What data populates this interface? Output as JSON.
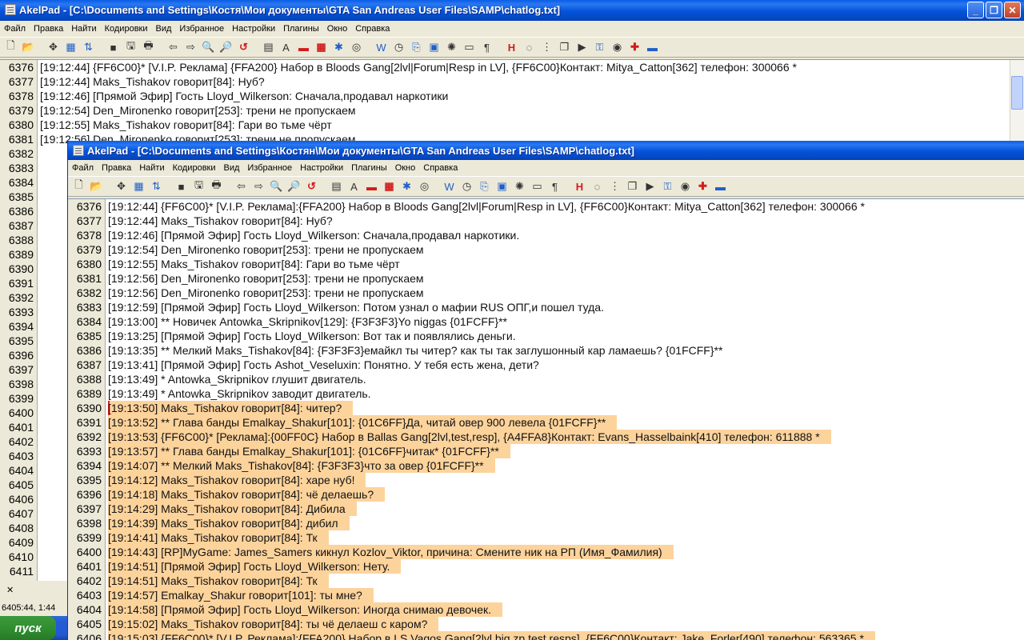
{
  "back_window": {
    "title": "AkelPad - [C:\\Documents and Settings\\Костя\\Мои документы\\GTA San Andreas User Files\\SAMP\\chatlog.txt]",
    "menu": [
      "Файл",
      "Правка",
      "Найти",
      "Кодировки",
      "Вид",
      "Избранное",
      "Настройки",
      "Плагины",
      "Окно",
      "Справка"
    ],
    "lines": [
      {
        "n": "6376",
        "t": "[19:12:44] {FF6C00}* [V.I.P. Реклама] {FFA200} Набор в Bloods Gang[2lvl|Forum|Resp in LV], {FF6C00}Контакт: Mitya_Catton[362] телефон: 300066 *"
      },
      {
        "n": "6377",
        "t": "[19:12:44] Maks_Tishakov говорит[84]: Нуб?"
      },
      {
        "n": "6378",
        "t": "[19:12:46]  [Прямой Эфир] Гость Lloyd_Wilkerson: Сначала,продавал наркотики"
      },
      {
        "n": "6379",
        "t": "[19:12:54] Den_Mironenko говорит[253]: трени не пропускаем"
      },
      {
        "n": "6380",
        "t": "[19:12:55] Maks_Tishakov говорит[84]: Гари во тьме чёрт"
      },
      {
        "n": "6381",
        "t": "[19:12:56] Den_Mironenko говорит[253]: трени не пропускаем"
      }
    ],
    "gutter_extra": [
      "6382",
      "6383",
      "6384",
      "6385",
      "6386",
      "6387",
      "6388",
      "6389",
      "6390",
      "6391",
      "6392",
      "6393",
      "6394",
      "6395",
      "6396",
      "6397",
      "6398",
      "6399",
      "6400",
      "6401",
      "6402",
      "6403",
      "6404",
      "6405",
      "6406",
      "6407",
      "6408",
      "6409",
      "6410",
      "6411"
    ],
    "status_text": "6405:44, 1:44",
    "start_label": "пуск"
  },
  "front_window": {
    "title": "AkelPad - [C:\\Documents and Settings\\Костян\\Мои документы\\GTA San Andreas User Files\\SAMP\\chatlog.txt]",
    "menu": [
      "Файл",
      "Правка",
      "Найти",
      "Кодировки",
      "Вид",
      "Избранное",
      "Настройки",
      "Плагины",
      "Окно",
      "Справка"
    ],
    "lines": [
      {
        "n": "6376",
        "t": "[19:12:44] {FF6C00}* [V.I.P. Реклама]:{FFA200} Набор в Bloods Gang[2lvl|Forum|Resp in LV], {FF6C00}Контакт: Mitya_Catton[362] телефон: 300066 *",
        "sel": false
      },
      {
        "n": "6377",
        "t": "[19:12:44] Maks_Tishakov говорит[84]: Нуб?",
        "sel": false
      },
      {
        "n": "6378",
        "t": "[19:12:46]  [Прямой Эфир] Гость Lloyd_Wilkerson: Сначала,продавал наркотики.",
        "sel": false
      },
      {
        "n": "6379",
        "t": "[19:12:54] Den_Mironenko говорит[253]: трени не пропускаем",
        "sel": false
      },
      {
        "n": "6380",
        "t": "[19:12:55] Maks_Tishakov говорит[84]: Гари во тьме чёрт",
        "sel": false
      },
      {
        "n": "6381",
        "t": "[19:12:56] Den_Mironenko говорит[253]: трени не пропускаем",
        "sel": false
      },
      {
        "n": "6382",
        "t": "[19:12:56] Den_Mironenko говорит[253]: трени не пропускаем",
        "sel": false
      },
      {
        "n": "6383",
        "t": "[19:12:59]  [Прямой Эфир] Гость Lloyd_Wilkerson: Потом узнал о мафии RUS ОПГ,и пошел туда.",
        "sel": false
      },
      {
        "n": "6384",
        "t": "[19:13:00] ** Новичек Antowka_Skripnikov[129]: {F3F3F3}Yo niggas {01FCFF}**",
        "sel": false
      },
      {
        "n": "6385",
        "t": "[19:13:25]  [Прямой Эфир] Гость Lloyd_Wilkerson: Вот так и появлялись деньги.",
        "sel": false
      },
      {
        "n": "6386",
        "t": "[19:13:35] ** Мелкий Maks_Tishakov[84]: {F3F3F3}емайкл ты читер? как ты так заглушонный кар ламаешь? {01FCFF}**",
        "sel": false
      },
      {
        "n": "6387",
        "t": "[19:13:41]  [Прямой Эфир] Гость Ashot_Veseluxin: Понятно. У тебя есть жена, дети?",
        "sel": false
      },
      {
        "n": "6388",
        "t": "[19:13:49] * Antowka_Skripnikov глушит двигатель.",
        "sel": false
      },
      {
        "n": "6389",
        "t": "[19:13:49] * Antowka_Skripnikov заводит двигатель.",
        "sel": false
      },
      {
        "n": "6390",
        "t": "[19:13:50] Maks_Tishakov говорит[84]: читер?",
        "sel": true,
        "cur": true
      },
      {
        "n": "6391",
        "t": "[19:13:52] ** Глава банды Emalkay_Shakur[101]: {01C6FF}Да, читай овер 900 левела {01FCFF}**",
        "sel": true
      },
      {
        "n": "6392",
        "t": "[19:13:53] {FF6C00}* [Реклама]:{00FF0C} Набор в Ballas Gang[2lvl,test,resp], {A4FFA8}Контакт: Evans_Hasselbaink[410] телефон: 611888 *",
        "sel": true
      },
      {
        "n": "6393",
        "t": "[19:13:57] ** Глава банды Emalkay_Shakur[101]: {01C6FF}читак* {01FCFF}**",
        "sel": true
      },
      {
        "n": "6394",
        "t": "[19:14:07] ** Мелкий Maks_Tishakov[84]: {F3F3F3}что за овер {01FCFF}**",
        "sel": true
      },
      {
        "n": "6395",
        "t": "[19:14:12] Maks_Tishakov говорит[84]: харе нуб!",
        "sel": true
      },
      {
        "n": "6396",
        "t": "[19:14:18] Maks_Tishakov говорит[84]: чё делаешь?",
        "sel": true
      },
      {
        "n": "6397",
        "t": "[19:14:29] Maks_Tishakov говорит[84]: Дибила",
        "sel": true
      },
      {
        "n": "6398",
        "t": "[19:14:39] Maks_Tishakov говорит[84]: дибил",
        "sel": true
      },
      {
        "n": "6399",
        "t": "[19:14:41] Maks_Tishakov говорит[84]: Тк",
        "sel": true
      },
      {
        "n": "6400",
        "t": "[19:14:43] [RP]MyGame: James_Samers кикнул Kozlov_Viktor, причина: Смените ник на РП (Имя_Фамилия)",
        "sel": true
      },
      {
        "n": "6401",
        "t": "[19:14:51]  [Прямой Эфир] Гость Lloyd_Wilkerson: Нету.",
        "sel": true
      },
      {
        "n": "6402",
        "t": "[19:14:51] Maks_Tishakov говорит[84]: Тк",
        "sel": true
      },
      {
        "n": "6403",
        "t": "[19:14:57] Emalkay_Shakur говорит[101]: ты мне?",
        "sel": true
      },
      {
        "n": "6404",
        "t": "[19:14:58]  [Прямой Эфир] Гость Lloyd_Wilkerson: Иногда снимаю девочек.",
        "sel": true
      },
      {
        "n": "6405",
        "t": "[19:15:02] Maks_Tishakov говорит[84]: ты чё делаеш с каром?",
        "sel": true
      },
      {
        "n": "6406",
        "t": "[19:15:03] {FF6C00}* [V.I.P. Реклама]:{FFA200} Набор в LS Vagos Gang[2lvl,big zp,test,resps], {FF6C00}Контакт: Jake_Forler[490] телефон: 563365 *",
        "sel": true
      }
    ]
  }
}
